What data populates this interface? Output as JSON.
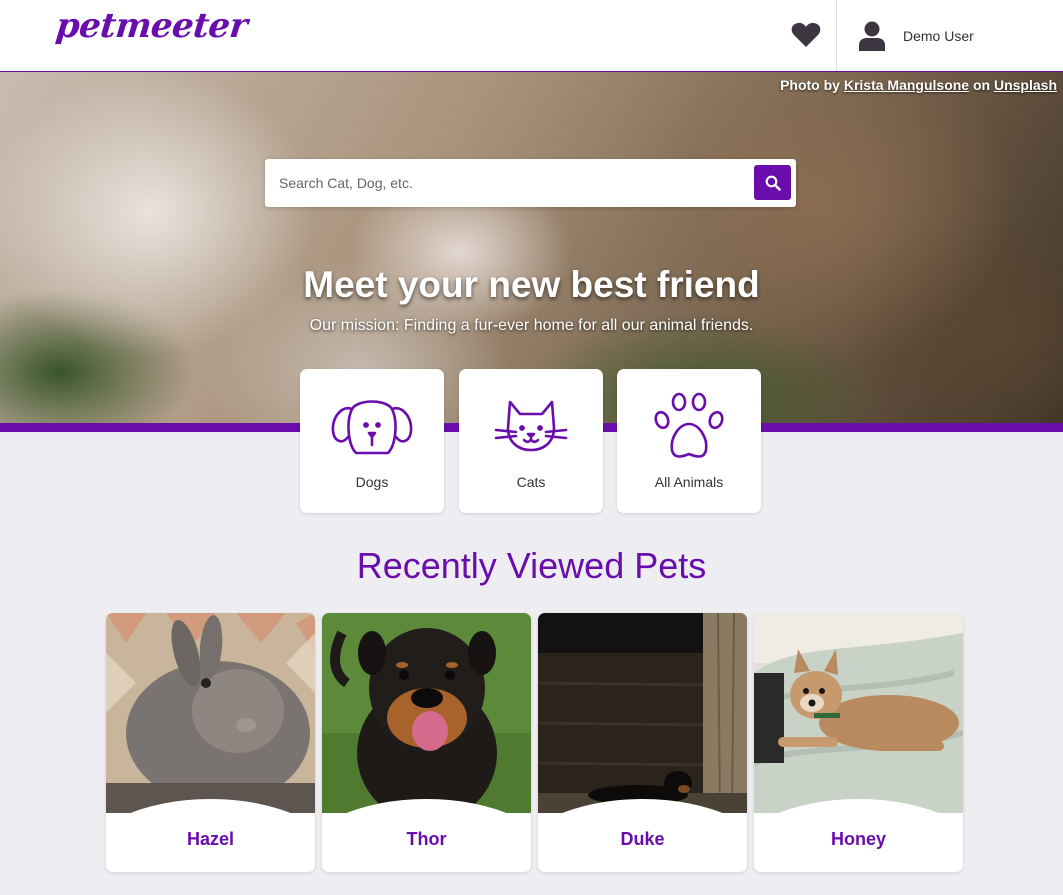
{
  "brand": {
    "logo_text": "petmeeter",
    "accent": "#6a0dad"
  },
  "header": {
    "favorites_icon": "heart-icon",
    "user_icon": "user-icon",
    "user_name": "Demo User"
  },
  "hero": {
    "credit_prefix": "Photo by ",
    "credit_author": "Krista Mangulsone",
    "credit_mid": " on ",
    "credit_site": "Unsplash",
    "search_placeholder": "Search Cat, Dog, etc.",
    "search_icon": "search-icon",
    "title": "Meet your new best friend",
    "subtitle": "Our mission: Finding a fur-ever home for all our animal friends."
  },
  "categories": [
    {
      "label": "Dogs",
      "icon": "dog-icon"
    },
    {
      "label": "Cats",
      "icon": "cat-icon"
    },
    {
      "label": "All Animals",
      "icon": "paw-icon"
    }
  ],
  "recent": {
    "title": "Recently Viewed Pets",
    "pets": [
      {
        "name": "Hazel"
      },
      {
        "name": "Thor"
      },
      {
        "name": "Duke"
      },
      {
        "name": "Honey"
      }
    ]
  }
}
